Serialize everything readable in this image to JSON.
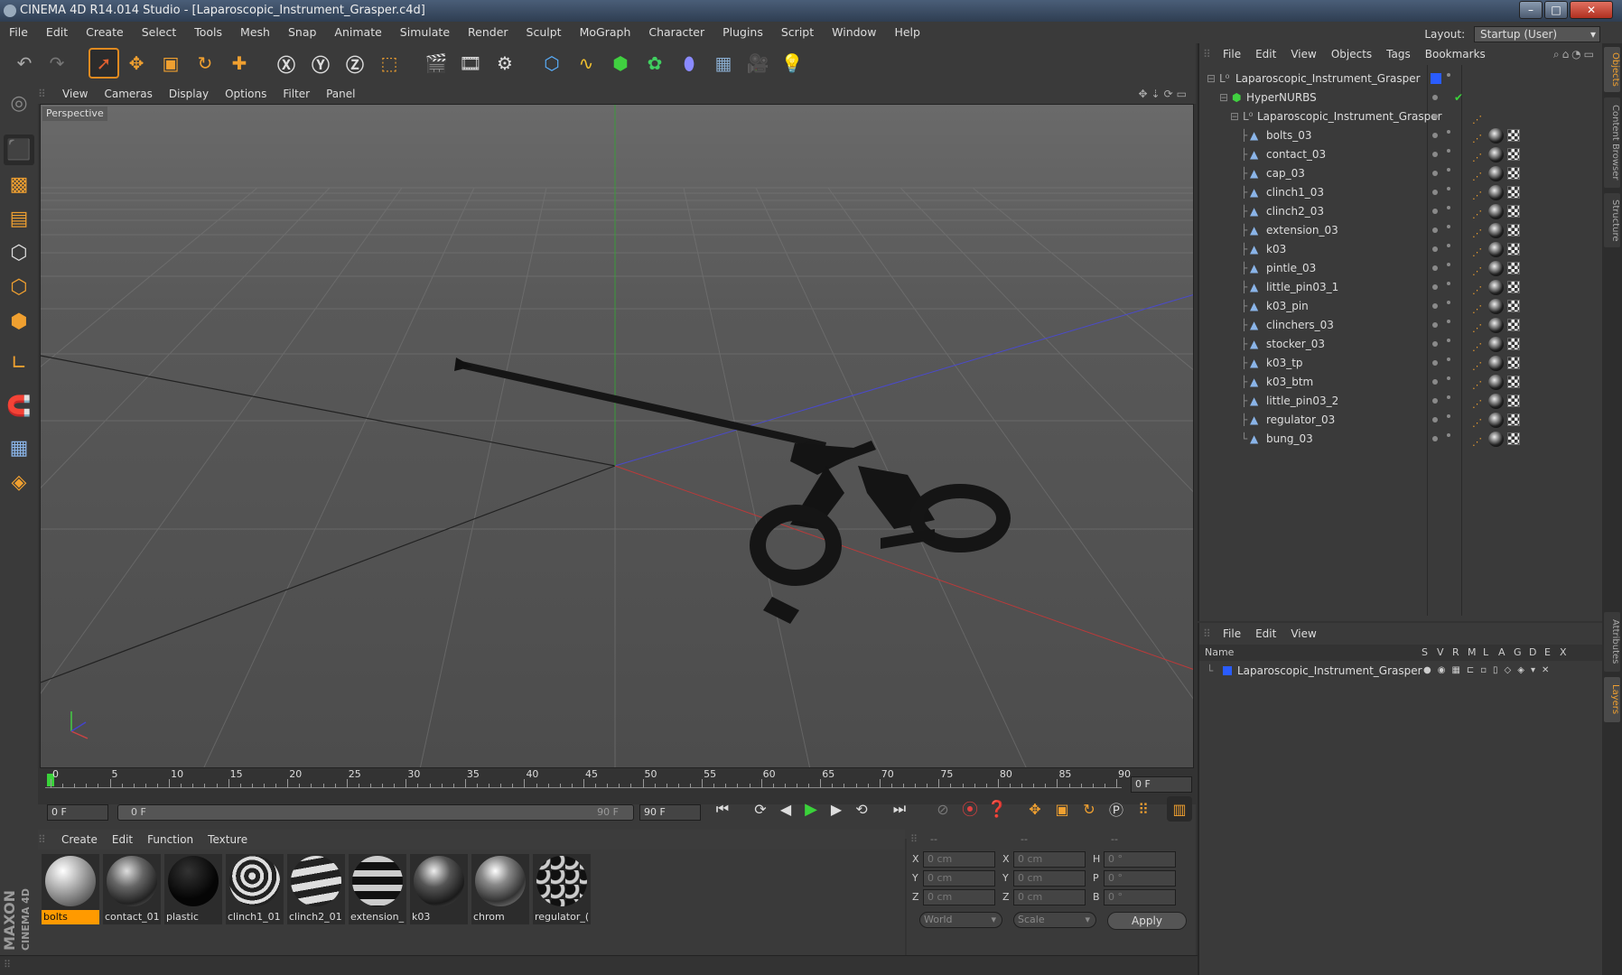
{
  "title": "CINEMA 4D R14.014 Studio - [Laparoscopic_Instrument_Grasper.c4d]",
  "menu": [
    "File",
    "Edit",
    "Create",
    "Select",
    "Tools",
    "Mesh",
    "Snap",
    "Animate",
    "Simulate",
    "Render",
    "Sculpt",
    "MoGraph",
    "Character",
    "Plugins",
    "Script",
    "Window",
    "Help"
  ],
  "layout": {
    "label": "Layout:",
    "value": "Startup (User)"
  },
  "viewport": {
    "menu": [
      "View",
      "Cameras",
      "Display",
      "Options",
      "Filter",
      "Panel"
    ],
    "label": "Perspective"
  },
  "timeline": {
    "ticks": [
      "0",
      "5",
      "10",
      "15",
      "20",
      "25",
      "30",
      "35",
      "40",
      "45",
      "50",
      "55",
      "60",
      "65",
      "70",
      "75",
      "80",
      "85",
      "90"
    ],
    "end_frame": "0 F"
  },
  "playback": {
    "start": "0 F",
    "range_start": "0 F",
    "range_end": "90 F",
    "max": "90 F"
  },
  "materials": {
    "menu": [
      "Create",
      "Edit",
      "Function",
      "Texture"
    ],
    "items": [
      "bolts",
      "contact_01",
      "plastic",
      "clinch1_01",
      "clinch2_01",
      "extension_",
      "k03",
      "chrom",
      "regulator_("
    ]
  },
  "coords": {
    "header": [
      "--",
      "--",
      "--"
    ],
    "rows": [
      [
        "X",
        "0 cm",
        "X",
        "0 cm",
        "H",
        "0 °"
      ],
      [
        "Y",
        "0 cm",
        "Y",
        "0 cm",
        "P",
        "0 °"
      ],
      [
        "Z",
        "0 cm",
        "Z",
        "0 cm",
        "B",
        "0 °"
      ]
    ],
    "mode1": "World",
    "mode2": "Scale",
    "apply": "Apply"
  },
  "objects": {
    "menu": [
      "File",
      "Edit",
      "View",
      "Objects",
      "Tags",
      "Bookmarks"
    ],
    "root": "Laparoscopic_Instrument_Grasper",
    "hypernurbs": "HyperNURBS",
    "group": "Laparoscopic_Instrument_Grasper",
    "items": [
      "bolts_03",
      "contact_03",
      "cap_03",
      "clinch1_03",
      "clinch2_03",
      "extension_03",
      "k03",
      "pintle_03",
      "little_pin03_1",
      "k03_pin",
      "clinchers_03",
      "stocker_03",
      "k03_tp",
      "k03_btm",
      "little_pin03_2",
      "regulator_03",
      "bung_03"
    ]
  },
  "layers": {
    "menu": [
      "File",
      "Edit",
      "View"
    ],
    "header": "Name",
    "cols": [
      "S",
      "V",
      "R",
      "M",
      "L",
      "A",
      "G",
      "D",
      "E",
      "X"
    ],
    "row": "Laparoscopic_Instrument_Grasper"
  },
  "sidetabs": [
    "Objects",
    "Content Browser",
    "Structure",
    "Attributes",
    "Layers"
  ],
  "brand": [
    "MAXON",
    "CINEMA 4D"
  ],
  "colors": {
    "accent": "#f0a030",
    "selected": "#ff9a00"
  }
}
